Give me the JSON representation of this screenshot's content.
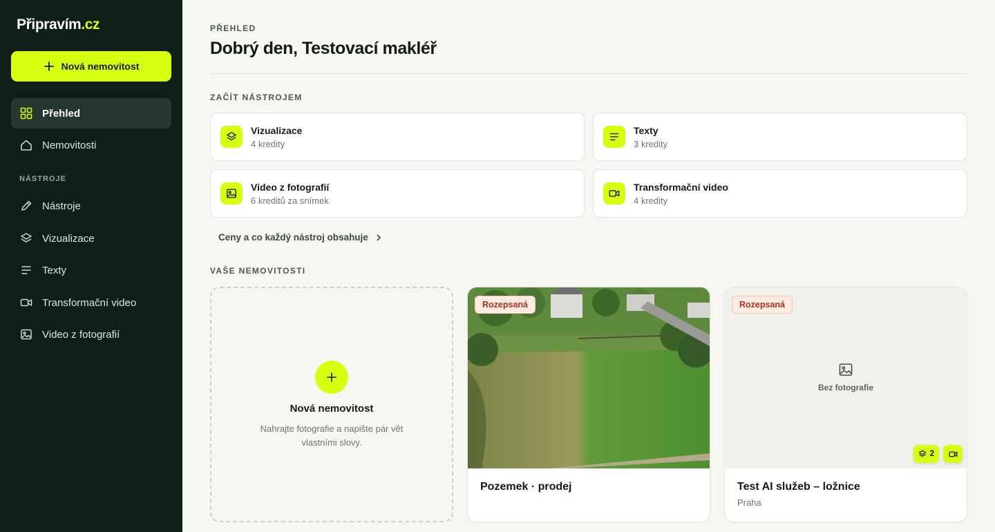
{
  "app": {
    "logo_main": "Připravím",
    "logo_accent": ".cz"
  },
  "sidebar": {
    "new_button": "Nová nemovitost",
    "primary_items": [
      {
        "label": "Přehled",
        "icon": "grid-icon",
        "active": true
      },
      {
        "label": "Nemovitosti",
        "icon": "home-icon",
        "active": false
      }
    ],
    "section_label": "NÁSTROJE",
    "tool_items": [
      {
        "label": "Nástroje",
        "icon": "pencil-icon"
      },
      {
        "label": "Vizualizace",
        "icon": "layers-icon"
      },
      {
        "label": "Texty",
        "icon": "text-lines-icon"
      },
      {
        "label": "Transformační video",
        "icon": "video-camera-icon"
      },
      {
        "label": "Video z fotografií",
        "icon": "image-icon"
      }
    ]
  },
  "header": {
    "eyebrow": "PŘEHLED",
    "title": "Dobrý den, Testovací makléř"
  },
  "tools_section": {
    "label": "ZAČÍT NÁSTROJEM",
    "cards": [
      {
        "name": "Vizualizace",
        "price": "4 kredity",
        "icon": "layers-icon"
      },
      {
        "name": "Texty",
        "price": "3 kredity",
        "icon": "text-lines-icon"
      },
      {
        "name": "Video z fotografií",
        "price": "6 kreditů za snímek",
        "icon": "image-icon"
      },
      {
        "name": "Transformační video",
        "price": "4 kredity",
        "icon": "video-camera-icon"
      }
    ],
    "pricing_link": "Ceny a co každý nástroj obsahuje"
  },
  "properties_section": {
    "label": "VAŠE NEMOVITOSTI",
    "new_card": {
      "title": "Nová nemovitost",
      "description": "Nahrajte fotografie a napište pár vět vlastními slovy."
    },
    "properties": [
      {
        "title": "Pozemek · prodej",
        "location": "",
        "status": "Rozepsaná",
        "has_photo": true
      },
      {
        "title": "Test AI služeb – ložnice",
        "location": "Praha",
        "status": "Rozepsaná",
        "has_photo": false,
        "no_photo_text": "Bez fotografie",
        "visualization_count": "2"
      }
    ]
  },
  "colors": {
    "accent": "#d7ff12",
    "sidebar_bg": "#0f1f18",
    "page_bg": "#f6f6f2",
    "badge_text": "#a3361c"
  }
}
